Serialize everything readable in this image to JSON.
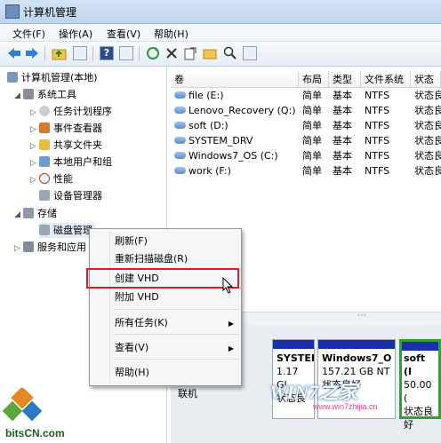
{
  "window": {
    "title": "计算机管理"
  },
  "menu": [
    "文件(F)",
    "操作(A)",
    "查看(V)",
    "帮助(H)"
  ],
  "toolbar": {
    "icons": [
      "back-icon",
      "forward-icon",
      "up-folder-icon",
      "show-hide-tree-icon",
      "help-icon",
      "properties-icon",
      "refresh-icon",
      "delete-icon",
      "export-icon",
      "open-icon",
      "search-icon",
      "zoom-icon"
    ]
  },
  "tree": {
    "root": "计算机管理(本地)",
    "system_tools": "系统工具",
    "task_scheduler": "任务计划程序",
    "event_viewer": "事件查看器",
    "shared_folders": "共享文件夹",
    "local_users": "本地用户和组",
    "performance": "性能",
    "device_manager": "设备管理器",
    "storage": "存储",
    "disk_management": "磁盘管理",
    "services_apps": "服务和应用"
  },
  "columns": [
    "卷",
    "布局",
    "类型",
    "文件系统",
    "状态"
  ],
  "volumes": [
    {
      "name": "file (E:)",
      "layout": "简单",
      "type": "基本",
      "fs": "NTFS",
      "status": "状态良"
    },
    {
      "name": "Lenovo_Recovery (Q:)",
      "layout": "简单",
      "type": "基本",
      "fs": "NTFS",
      "status": "状态良"
    },
    {
      "name": "soft (D:)",
      "layout": "简单",
      "type": "基本",
      "fs": "NTFS",
      "status": "状态良"
    },
    {
      "name": "SYSTEM_DRV",
      "layout": "简单",
      "type": "基本",
      "fs": "NTFS",
      "status": "状态良"
    },
    {
      "name": "Windows7_OS (C:)",
      "layout": "简单",
      "type": "基本",
      "fs": "NTFS",
      "status": "状态良"
    },
    {
      "name": "work (F:)",
      "layout": "简单",
      "type": "基本",
      "fs": "NTFS",
      "status": "状态良"
    }
  ],
  "disk_panel": {
    "online": "联机",
    "partitions": [
      {
        "title": "SYSTEI",
        "size": "1.17 GI",
        "status": "状态良"
      },
      {
        "title": "Windows7_O",
        "size": "157.21 GB NT",
        "status": "状态良好"
      },
      {
        "title": "soft (I",
        "size": "50.00 (",
        "status": "状态良好"
      }
    ]
  },
  "context_menu": {
    "refresh": "刷新(F)",
    "rescan": "重新扫描磁盘(R)",
    "create_vhd": "创建 VHD",
    "attach_vhd": "附加 VHD",
    "all_tasks": "所有任务(K)",
    "view": "查看(V)",
    "help": "帮助(H)"
  },
  "watermark": {
    "left": "bitsCN.com",
    "right_logo": "WIN7之家",
    "right_url": "www.win7zhijia.cn"
  },
  "colors": {
    "accent": "#1a2fa8",
    "highlight": "#e01d1d",
    "green_part": "#2da42d"
  }
}
